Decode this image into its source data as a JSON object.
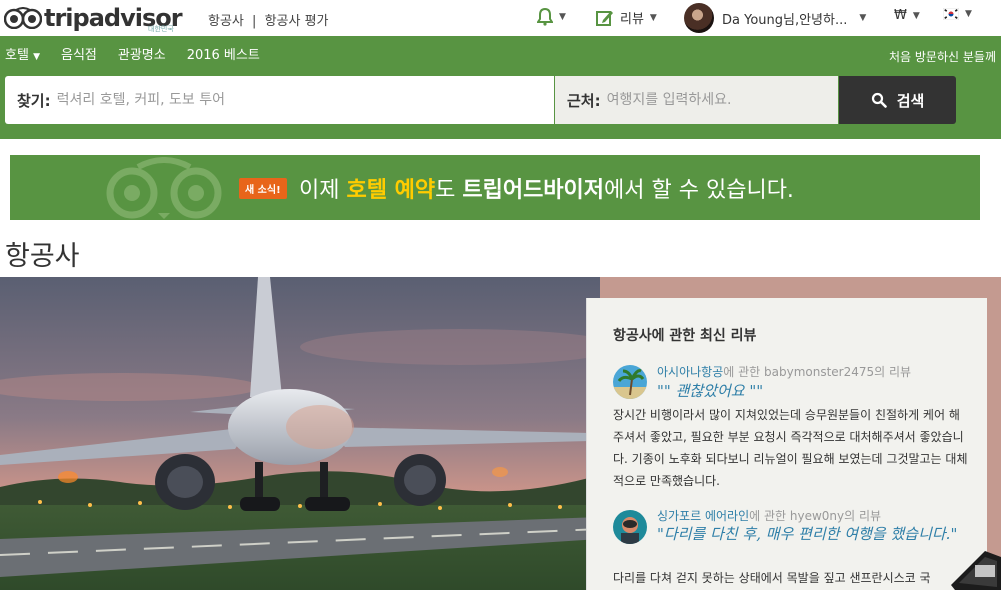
{
  "topbar": {
    "logo_text": "tripadvisor",
    "logo_sub": "대한민국",
    "breadcrumb": [
      "항공사",
      "항공사 평가"
    ],
    "breadcrumb_sep": "|",
    "review_label": "리뷰",
    "user_greeting": "Da Young님,안녕하...",
    "currency": "₩",
    "flag": "KR"
  },
  "nav": {
    "items": [
      "호텔",
      "음식점",
      "관광명소",
      "2016 베스트"
    ],
    "right_link": "처음 방문하신 분들께"
  },
  "search": {
    "find_label": "찾기:",
    "find_placeholder": "럭셔리 호텔, 커피, 도보 투어",
    "near_label": "근처:",
    "near_placeholder": "여행지를 입력하세요.",
    "button_label": "검색"
  },
  "promo": {
    "badge": "새 소식!",
    "text_1": "이제 ",
    "text_hl1": "호텔 예약",
    "text_2": "도 ",
    "text_hl2": "트립어드바이저",
    "text_3": "에서 할 수 있습니다."
  },
  "page": {
    "title": "항공사"
  },
  "reviews": {
    "title": "항공사에 관한 최신 리뷰",
    "items": [
      {
        "airline": "아시아나항공",
        "meta_rest": "에 관한 babymonster2475의 리뷰",
        "quote": "\"\" 괜찮았어요 \"\"",
        "body": "장시간 비행이라서 많이 지쳐있었는데 승무원분들이 친절하게 케어 해주셔서 좋았고, 필요한 부분 요청시 즉각적으로 대처해주셔서 좋았습니다. 기종이 노후화 되다보니 리뉴얼이 필요해 보였는데 그것말고는 대체적으로 만족했습니다."
      },
      {
        "airline": "싱가포르 에어라인",
        "meta_rest": "에 관한 hyew0ny의 리뷰",
        "quote": "\"다리를 다친 후, 매우 편리한 여행을 했습니다.\"",
        "body": "다리를 다쳐 걷지 못하는 상태에서 목발을 짚고 샌프란시스코 국"
      }
    ]
  },
  "colors": {
    "brand_green": "#589442",
    "search_button": "#333333",
    "promo_badge": "#e8651a",
    "highlight_yellow": "#ffcc00",
    "review_link": "#2f7fa8"
  }
}
